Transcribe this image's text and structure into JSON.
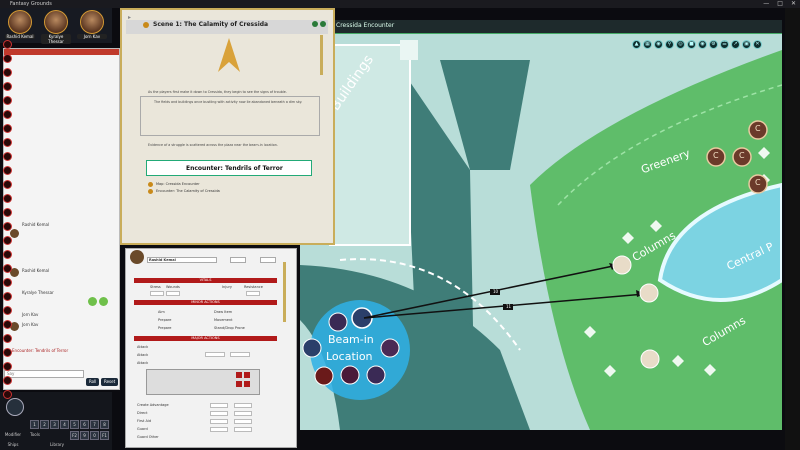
{
  "window": {
    "title": "Fantasy Grounds"
  },
  "portraits": [
    {
      "label": "Rashid Kemal"
    },
    {
      "label": "Kyralye Thessar"
    },
    {
      "label": "Jorn Kav"
    }
  ],
  "scene": {
    "header_title": "Cressida Encounter",
    "labels": {
      "buildings": "Buildings",
      "greenery": "Greenery",
      "columns_1": "Columns",
      "columns_2": "Columns",
      "central": "Central P",
      "beam_in": "Beam-in",
      "location": "Location"
    },
    "distance_1": "10",
    "distance_2": "11",
    "token_letter": "C"
  },
  "story": {
    "title": "Scene 1: The Calamity of Cressida",
    "paragraph_1": "As the players first make it down to Cressida, they begin to see the signs of trouble.",
    "paragraph_2": "The fields and buildings once bustling with activity now lie abandoned beneath a dim sky.",
    "paragraph_3": "Evidence of a struggle is scattered across the plaza near the beam-in location.",
    "encounter": "Encounter: Tendrils of Terror",
    "map_label": "Map: Cressida Encounter",
    "encounter_label": "Encounter: The Calamity of Cressida"
  },
  "sheet": {
    "name": "Rashid Kemal",
    "bands": {
      "vitals": "VITALS",
      "minor_actions": "MINOR ACTIONS",
      "major_actions": "MAJOR ACTIONS"
    },
    "stress_label": "Stress",
    "wounds_label": "Wounds",
    "injury_label": "Injury",
    "resistance_label": "Resistance",
    "actions_left": [
      "Aim",
      "Prepare",
      "Prepare"
    ],
    "actions_right": [
      "Draw Item",
      "Movement",
      "Stand/Drop Prone"
    ],
    "attack_rows": [
      "Attack",
      "Attack",
      "Attack"
    ],
    "stat_rows": [
      "Create Advantage",
      "Direct",
      "First Aid",
      "Guard",
      "Guard Other"
    ]
  },
  "chat": {
    "messages": [
      "Rashid Kemal",
      "Rashid Kemal",
      "Kyralye Thessar",
      "Jorn Kav",
      "Jorn Kav",
      "Encounter: Tendrils of Terror"
    ],
    "input_placeholder": "Say",
    "send_label": "Roll",
    "reset_label": "Reset"
  },
  "hotbar": {
    "keys": [
      "1",
      "2",
      "3",
      "4",
      "5",
      "6",
      "7",
      "8",
      "9",
      "0",
      "F1",
      "F2"
    ],
    "labels": [
      "Modifier",
      "Tools",
      "Library",
      "Ships"
    ]
  },
  "colors": {
    "plaza": "#b8ddd8",
    "grass": "#5fbd6a",
    "path": "#3f7d78",
    "beam": "#2fb0e6",
    "accent": "#c9ad5a"
  }
}
